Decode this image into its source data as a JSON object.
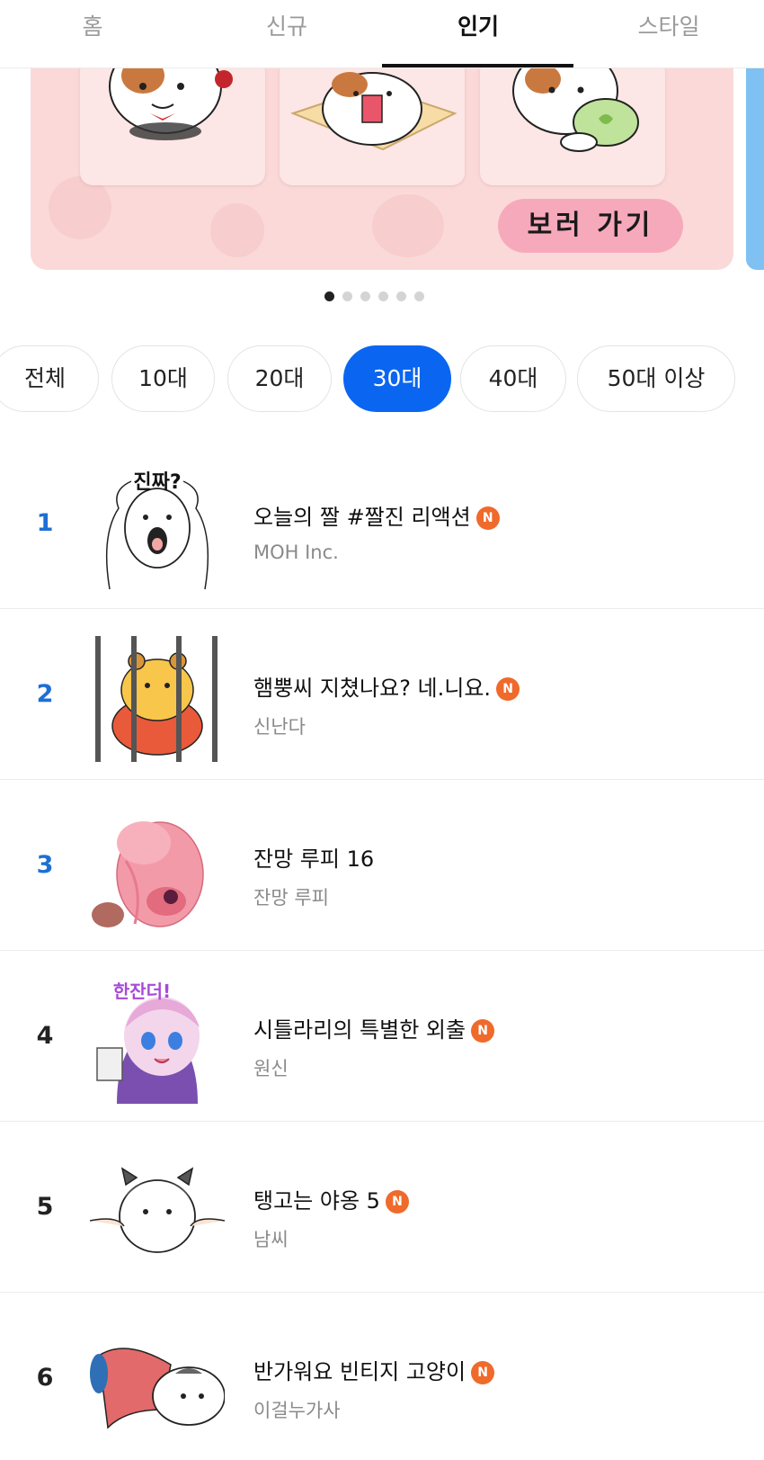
{
  "tabs": [
    {
      "label": "홈",
      "active": false
    },
    {
      "label": "신규",
      "active": false
    },
    {
      "label": "인기",
      "active": true
    },
    {
      "label": "스타일",
      "active": false
    }
  ],
  "banner": {
    "button_label": "보러 가기",
    "page_count": 6,
    "active_page": 1
  },
  "age_filters": [
    {
      "label": "전체",
      "active": false
    },
    {
      "label": "10대",
      "active": false
    },
    {
      "label": "20대",
      "active": false
    },
    {
      "label": "30대",
      "active": true
    },
    {
      "label": "40대",
      "active": false
    },
    {
      "label": "50대 이상",
      "active": false
    }
  ],
  "ranking": [
    {
      "rank": "1",
      "title": "오늘의 짤 #짤진 리액션",
      "creator": "MOH Inc.",
      "is_new": true
    },
    {
      "rank": "2",
      "title": "햄뿡씨 지쳤나요? 네.니요.",
      "creator": "신난다",
      "is_new": true
    },
    {
      "rank": "3",
      "title": "잔망 루피 16",
      "creator": "잔망 루피",
      "is_new": false
    },
    {
      "rank": "4",
      "title": "시틀라리의 특별한 외출",
      "creator": "원신",
      "is_new": true
    },
    {
      "rank": "5",
      "title": "탱고는 야옹 5",
      "creator": "남씨",
      "is_new": true
    },
    {
      "rank": "6",
      "title": "반가워요 빈티지 고양이",
      "creator": "이걸누가사",
      "is_new": true
    }
  ],
  "new_badge_label": "N",
  "sticker_texts": {
    "rank1": "진짜?",
    "rank4": "한잔더!"
  },
  "colors": {
    "accent_blue": "#0a66f0",
    "rank_blue": "#1d6fd6",
    "new_badge": "#ef6a2b",
    "banner_bg": "#fbd9d9",
    "banner_button": "#f7a9bc"
  }
}
